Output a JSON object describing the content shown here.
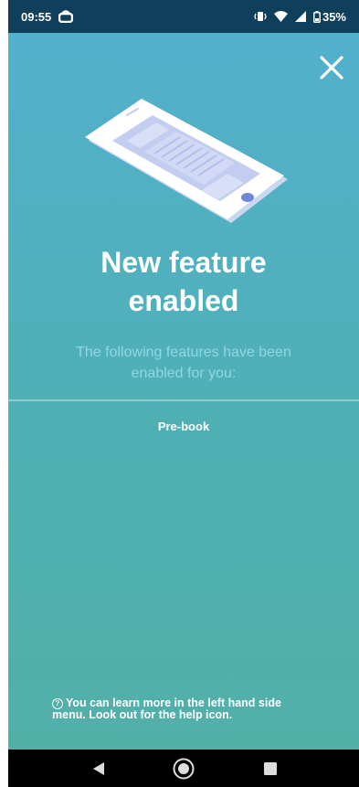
{
  "status_bar": {
    "time": "09:55",
    "battery": "35%",
    "icons": [
      "app-notification-icon",
      "vibrate-icon",
      "wifi-icon",
      "signal-icon",
      "battery-icon"
    ]
  },
  "dialog": {
    "close_icon": "close-icon",
    "illustration": "phone-illustration",
    "title_line1": "New feature",
    "title_line2": "enabled",
    "subtitle_line1": "The following features have been",
    "subtitle_line2": "enabled for you:",
    "features": [
      "Pre-book"
    ],
    "help_line1": "You can learn more in the left hand side",
    "help_line2": "menu. Look out for the help icon.",
    "help_icon_glyph": "?"
  },
  "nav_bar": {
    "icons": [
      "back-icon",
      "home-icon",
      "recents-icon"
    ]
  },
  "colors": {
    "status_bar_bg": "#0f3f5a",
    "gradient_top": "#52b0cd",
    "gradient_bottom": "#52afa8",
    "subtitle": "#92d6e2",
    "text": "#ffffff"
  }
}
